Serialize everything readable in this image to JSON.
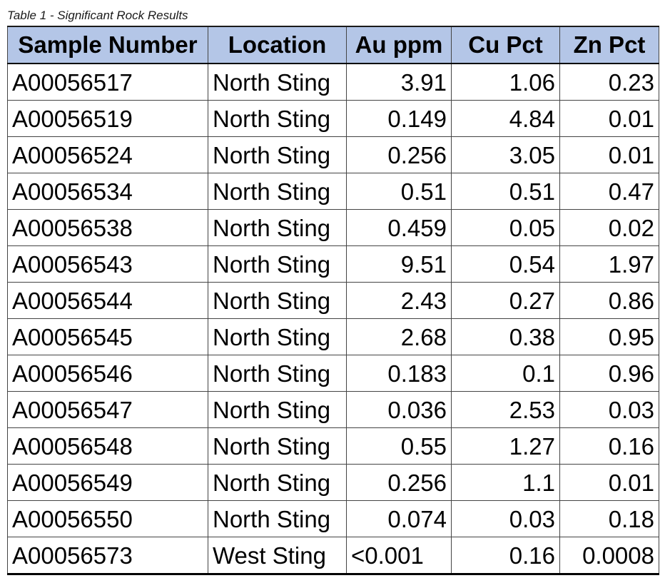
{
  "caption": "Table 1 - Significant Rock Results",
  "colors": {
    "header_bg": "#b4c6e7",
    "border": "#444444"
  },
  "table": {
    "headers": [
      "Sample Number",
      "Location",
      "Au ppm",
      "Cu Pct",
      "Zn Pct"
    ],
    "rows": [
      [
        "A00056517",
        "North Sting",
        "3.91",
        "1.06",
        "0.23"
      ],
      [
        "A00056519",
        "North Sting",
        "0.149",
        "4.84",
        "0.01"
      ],
      [
        "A00056524",
        "North Sting",
        "0.256",
        "3.05",
        "0.01"
      ],
      [
        "A00056534",
        "North Sting",
        "0.51",
        "0.51",
        "0.47"
      ],
      [
        "A00056538",
        "North Sting",
        "0.459",
        "0.05",
        "0.02"
      ],
      [
        "A00056543",
        "North Sting",
        "9.51",
        "0.54",
        "1.97"
      ],
      [
        "A00056544",
        "North Sting",
        "2.43",
        "0.27",
        "0.86"
      ],
      [
        "A00056545",
        "North Sting",
        "2.68",
        "0.38",
        "0.95"
      ],
      [
        "A00056546",
        "North Sting",
        "0.183",
        "0.1",
        "0.96"
      ],
      [
        "A00056547",
        "North Sting",
        "0.036",
        "2.53",
        "0.03"
      ],
      [
        "A00056548",
        "North Sting",
        "0.55",
        "1.27",
        "0.16"
      ],
      [
        "A00056549",
        "North Sting",
        "0.256",
        "1.1",
        "0.01"
      ],
      [
        "A00056550",
        "North Sting",
        "0.074",
        "0.03",
        "0.18"
      ],
      [
        "A00056573",
        "West Sting",
        "<0.001",
        "0.16",
        "0.0008"
      ]
    ]
  }
}
